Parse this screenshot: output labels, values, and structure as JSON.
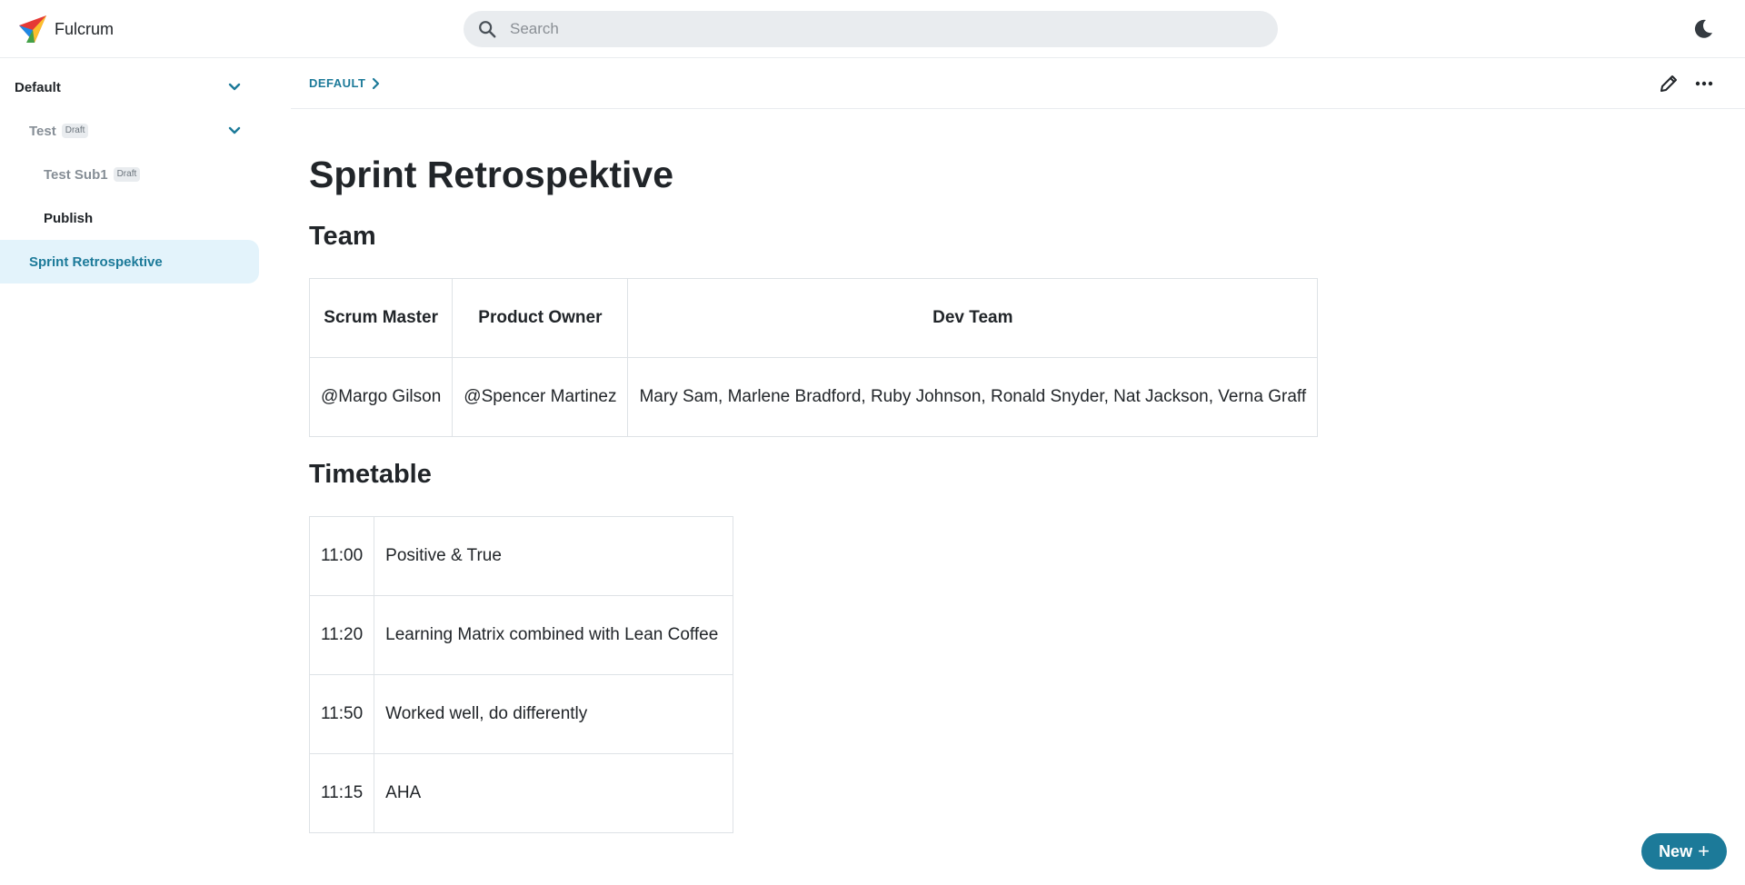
{
  "app": {
    "name": "Fulcrum"
  },
  "search": {
    "placeholder": "Search"
  },
  "sidebar": {
    "items": [
      {
        "label": "Default",
        "badge": ""
      },
      {
        "label": "Test",
        "badge": "Draft"
      },
      {
        "label": "Test Sub1",
        "badge": "Draft"
      },
      {
        "label": "Publish",
        "badge": ""
      },
      {
        "label": "Sprint Retrospektive",
        "badge": ""
      }
    ]
  },
  "breadcrumb": {
    "label": "DEFAULT"
  },
  "page": {
    "title": "Sprint Retrospektive",
    "team_heading": "Team",
    "team_table": {
      "headers": [
        "Scrum Master",
        "Product Owner",
        "Dev Team"
      ],
      "row": [
        "@Margo Gilson",
        "@Spencer Martinez",
        "Mary Sam, Marlene Bradford, Ruby Johnson, Ronald Snyder, Nat Jackson, Verna Graff"
      ]
    },
    "timetable_heading": "Timetable",
    "timetable": [
      {
        "time": "11:00",
        "activity": "Positive & True"
      },
      {
        "time": "11:20",
        "activity": "Learning Matrix combined with Lean Coffee"
      },
      {
        "time": "11:50",
        "activity": "Worked well, do differently"
      },
      {
        "time": "11:15",
        "activity": "AHA"
      }
    ]
  },
  "actions": {
    "new_label": "New"
  },
  "colors": {
    "accent": "#1c7a99",
    "active_bg": "#e3f3fb"
  },
  "icons": [
    "logo-icon",
    "search-icon",
    "moon-icon",
    "chevron-down-icon",
    "chevron-right-icon",
    "pencil-icon",
    "more-icon",
    "plus-icon"
  ]
}
